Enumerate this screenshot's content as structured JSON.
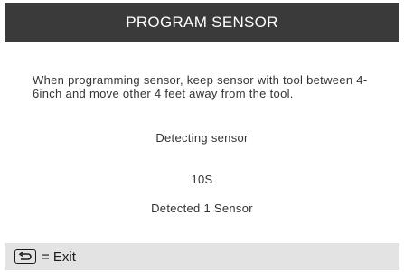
{
  "header": {
    "title": "PROGRAM SENSOR"
  },
  "content": {
    "instruction": "When programming sensor, keep sensor with tool between 4-6inch and move other 4 feet away from the tool.",
    "status": "Detecting sensor",
    "timer": "10S",
    "result": "Detected 1 Sensor"
  },
  "footer": {
    "back_icon": "return-arrow-icon",
    "exit_label": "= Exit"
  },
  "colors": {
    "titlebar_bg": "#3a3a3a",
    "footer_bg": "#e3e3e3",
    "text": "#333333"
  }
}
